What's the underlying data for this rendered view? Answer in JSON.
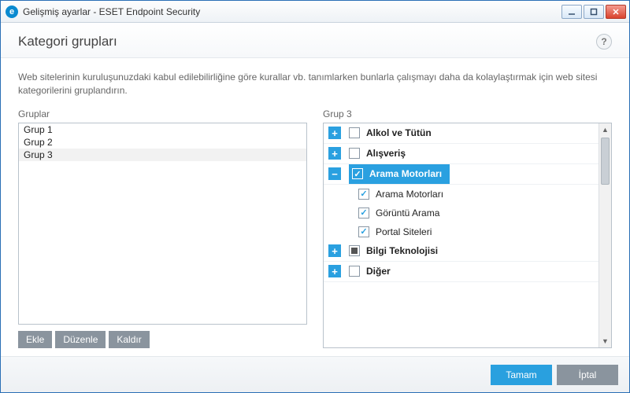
{
  "window": {
    "title": "Gelişmiş ayarlar - ESET Endpoint Security"
  },
  "header": {
    "title": "Kategori grupları",
    "help": "?"
  },
  "description": "Web sitelerinin kuruluşunuzdaki kabul edilebilirliğine göre kurallar vb. tanımlarken bunlarla çalışmayı daha da kolaylaştırmak için web sitesi kategorilerini gruplandırın.",
  "groups": {
    "label": "Gruplar",
    "items": [
      "Grup 1",
      "Grup 2",
      "Grup 3"
    ],
    "selected_index": 2
  },
  "detail": {
    "label": "Grup 3",
    "tree": [
      {
        "label": "Alkol ve Tütün",
        "bold": true,
        "expand": "plus",
        "check": "unchecked"
      },
      {
        "label": "Alışveriş",
        "bold": true,
        "expand": "plus",
        "check": "unchecked"
      },
      {
        "label": "Arama Motorları",
        "bold": true,
        "expand": "minus",
        "check": "checked",
        "selected": true,
        "children": [
          {
            "label": "Arama Motorları",
            "check": "checked"
          },
          {
            "label": "Görüntü Arama",
            "check": "checked"
          },
          {
            "label": "Portal Siteleri",
            "check": "checked"
          }
        ]
      },
      {
        "label": "Bilgi Teknolojisi",
        "bold": true,
        "expand": "plus",
        "check": "mixed"
      },
      {
        "label": "Diğer",
        "bold": true,
        "expand": "plus",
        "check": "unchecked"
      }
    ]
  },
  "buttons": {
    "add": "Ekle",
    "edit": "Düzenle",
    "remove": "Kaldır"
  },
  "footer": {
    "ok": "Tamam",
    "cancel": "İptal"
  }
}
